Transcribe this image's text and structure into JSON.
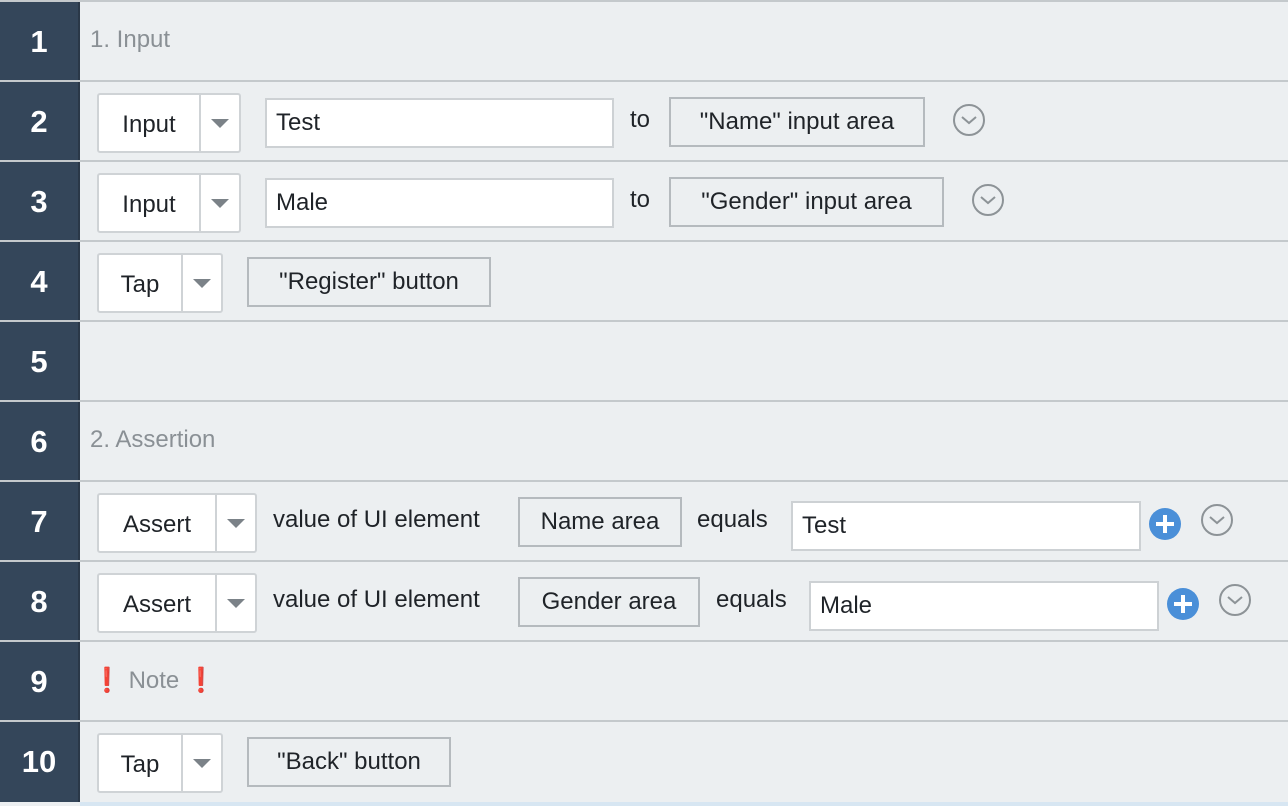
{
  "rows": [
    {
      "number": "1",
      "comment": "1. Input"
    },
    {
      "number": "2",
      "action": "Input",
      "value": "Test",
      "connector": "to",
      "target": "\"Name\" input area"
    },
    {
      "number": "3",
      "action": "Input",
      "value": "Male",
      "connector": "to",
      "target": "\"Gender\" input area"
    },
    {
      "number": "4",
      "action": "Tap",
      "target": "\"Register\" button"
    },
    {
      "number": "5"
    },
    {
      "number": "6",
      "comment": "2. Assertion"
    },
    {
      "number": "7",
      "action": "Assert",
      "phrase": "value of UI element",
      "target": "Name area",
      "operator": "equals",
      "expected": "Test"
    },
    {
      "number": "8",
      "action": "Assert",
      "phrase": "value of UI element",
      "target": "Gender area",
      "operator": "equals",
      "expected": "Male"
    },
    {
      "number": "9",
      "note_mark": "❗",
      "note": "Note"
    },
    {
      "number": "10",
      "action": "Tap",
      "target": "\"Back\" button"
    }
  ],
  "icons": {
    "dropdown": "caret-down-icon",
    "options": "chevron-circle-down-icon",
    "add": "plus-circle-icon",
    "note_mark": "exclamation-icon"
  },
  "colors": {
    "gutter": "#34465a",
    "row_background": "#eceff1",
    "accent": "#4a8fd8",
    "alert": "#d0021b",
    "comment_text": "#8a9095"
  }
}
